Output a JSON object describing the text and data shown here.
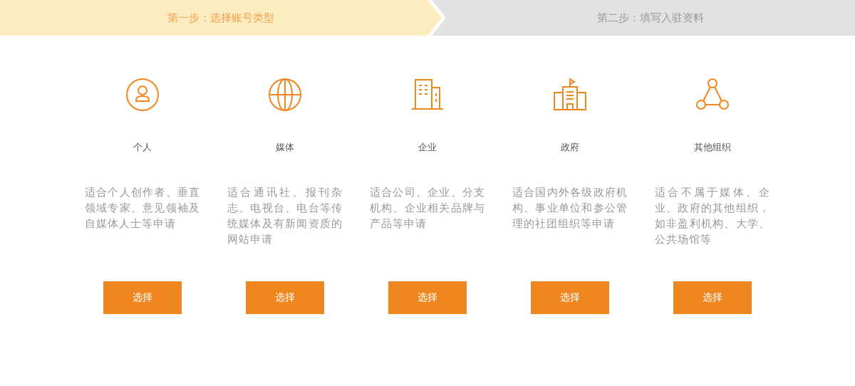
{
  "steps": [
    {
      "label": "第一步：选择账号类型",
      "selected": true
    },
    {
      "label": "第二步：填写入驻资料",
      "selected": false
    }
  ],
  "account_types": [
    {
      "kind": "person",
      "title": "个人",
      "description": "适合个人创作者、垂直领域专家、意见领袖及自媒体人士等申请",
      "button": "选择"
    },
    {
      "kind": "globe",
      "title": "媒体",
      "description": "适合通讯社、报刊杂志、电视台、电台等传统媒体及有新闻资质的网站申请",
      "button": "选择"
    },
    {
      "kind": "building",
      "title": "企业",
      "description": "适合公司、企业、分支机构、企业相关品牌与产品等申请",
      "button": "选择"
    },
    {
      "kind": "government",
      "title": "政府",
      "description": "适合国内外各级政府机构、事业单位和参公管理的社团组织等申请",
      "button": "选择"
    },
    {
      "kind": "network",
      "title": "其他组织",
      "description": "适合不属于媒体、企业、政府的其他组织，如非盈利机构、大学、公共场馆等",
      "button": "选择"
    }
  ]
}
